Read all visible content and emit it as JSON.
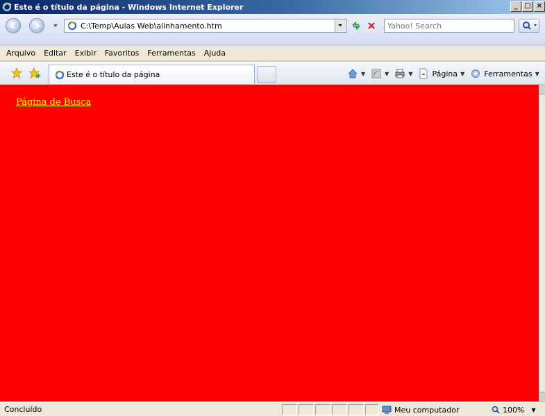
{
  "window": {
    "title": "Este é o título da página - Windows Internet Explorer",
    "controls": {
      "minimize": "_",
      "maximize": "□",
      "close": "×"
    }
  },
  "navigation": {
    "back_icon": "back-arrow-icon",
    "forward_icon": "forward-arrow-icon",
    "address": "C:\\Temp\\Aulas Web\\alinhamento.htm",
    "search_placeholder": "Yahoo! Search"
  },
  "menu": {
    "items": [
      "Arquivo",
      "Editar",
      "Exibir",
      "Favoritos",
      "Ferramentas",
      "Ajuda"
    ]
  },
  "tabs": [
    {
      "title": "Este é o título da página"
    }
  ],
  "command_bar": {
    "page_label": "Página",
    "tools_label": "Ferramentas"
  },
  "content": {
    "background_color": "#ff0000",
    "link_text": "Página de Busca",
    "link_color": "#ffff00"
  },
  "status": {
    "text": "Concluído",
    "zone": "Meu computador",
    "zoom": "100%"
  }
}
